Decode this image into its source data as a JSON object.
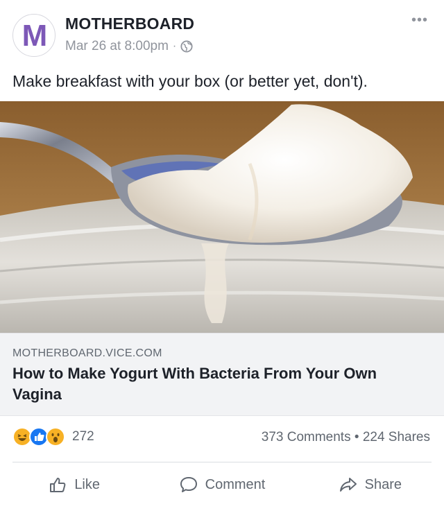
{
  "post": {
    "page_name": "MOTHERBOARD",
    "avatar_letter": "M",
    "timestamp": "Mar 26 at 8:00pm",
    "separator": "·",
    "more_icon": "more-horizontal-icon",
    "caption": "Make breakfast with your box (or better yet, don't)."
  },
  "link": {
    "domain": "MOTHERBOARD.VICE.COM",
    "title": "How to Make Yogurt With Bacteria From Your Own Vagina"
  },
  "engagement": {
    "reaction_count": "272",
    "reactions": [
      "haha",
      "like",
      "wow"
    ],
    "comments": "373 Comments",
    "dot": "•",
    "shares": "224 Shares"
  },
  "actions": {
    "like": "Like",
    "comment": "Comment",
    "share": "Share"
  },
  "colors": {
    "brand_purple": "#7d58b7",
    "like_blue": "#1877f2",
    "reaction_yellow": "#f7b125",
    "muted_text": "#606770"
  }
}
